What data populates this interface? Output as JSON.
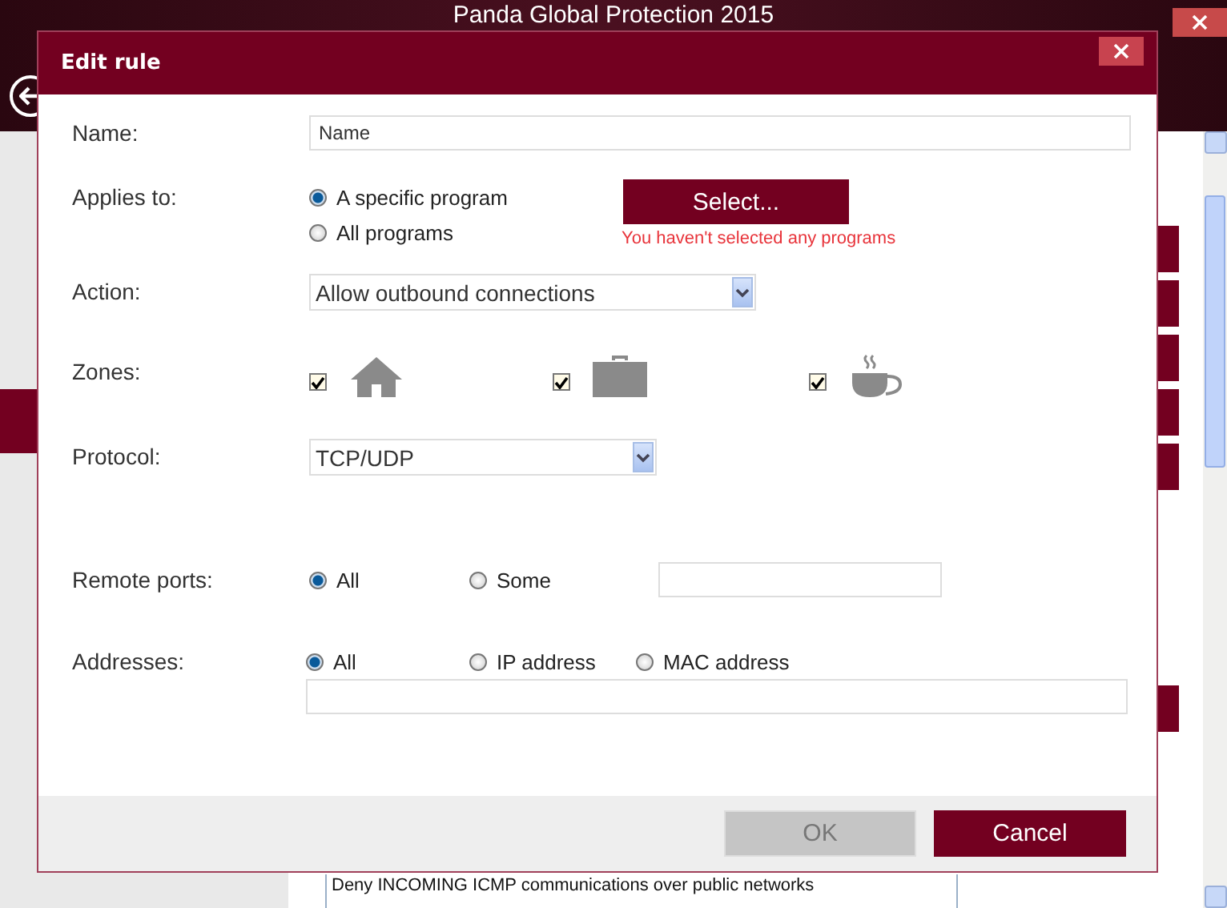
{
  "app": {
    "title": "Panda Global Protection 2015",
    "sidebar": {
      "items": [
        {
          "selected": true
        }
      ]
    },
    "list_item": "Deny INCOMING ICMP communications over public networks"
  },
  "dialog": {
    "title": "Edit rule",
    "name": {
      "label": "Name:",
      "value": "Name"
    },
    "applies_to": {
      "label": "Applies to:",
      "options": [
        {
          "label": "A specific program",
          "selected": true
        },
        {
          "label": "All programs",
          "selected": false
        }
      ],
      "button": "Select...",
      "error": "You haven't selected any programs"
    },
    "action": {
      "label": "Action:",
      "value": "Allow outbound connections"
    },
    "zones": {
      "label": "Zones:",
      "items": [
        {
          "kind": "home",
          "checked": true
        },
        {
          "kind": "work",
          "checked": true
        },
        {
          "kind": "public",
          "checked": true
        }
      ]
    },
    "protocol": {
      "label": "Protocol:",
      "value": "TCP/UDP"
    },
    "remote_ports": {
      "label": "Remote ports:",
      "options": [
        {
          "label": "All",
          "selected": true
        },
        {
          "label": "Some",
          "selected": false
        }
      ]
    },
    "addresses": {
      "label": "Addresses:",
      "options": [
        {
          "label": "All",
          "selected": true
        },
        {
          "label": "IP address",
          "selected": false
        },
        {
          "label": "MAC address",
          "selected": false
        }
      ]
    },
    "buttons": [
      {
        "label": "OK",
        "disabled": true
      },
      {
        "label": "Cancel",
        "disabled": false
      }
    ]
  }
}
